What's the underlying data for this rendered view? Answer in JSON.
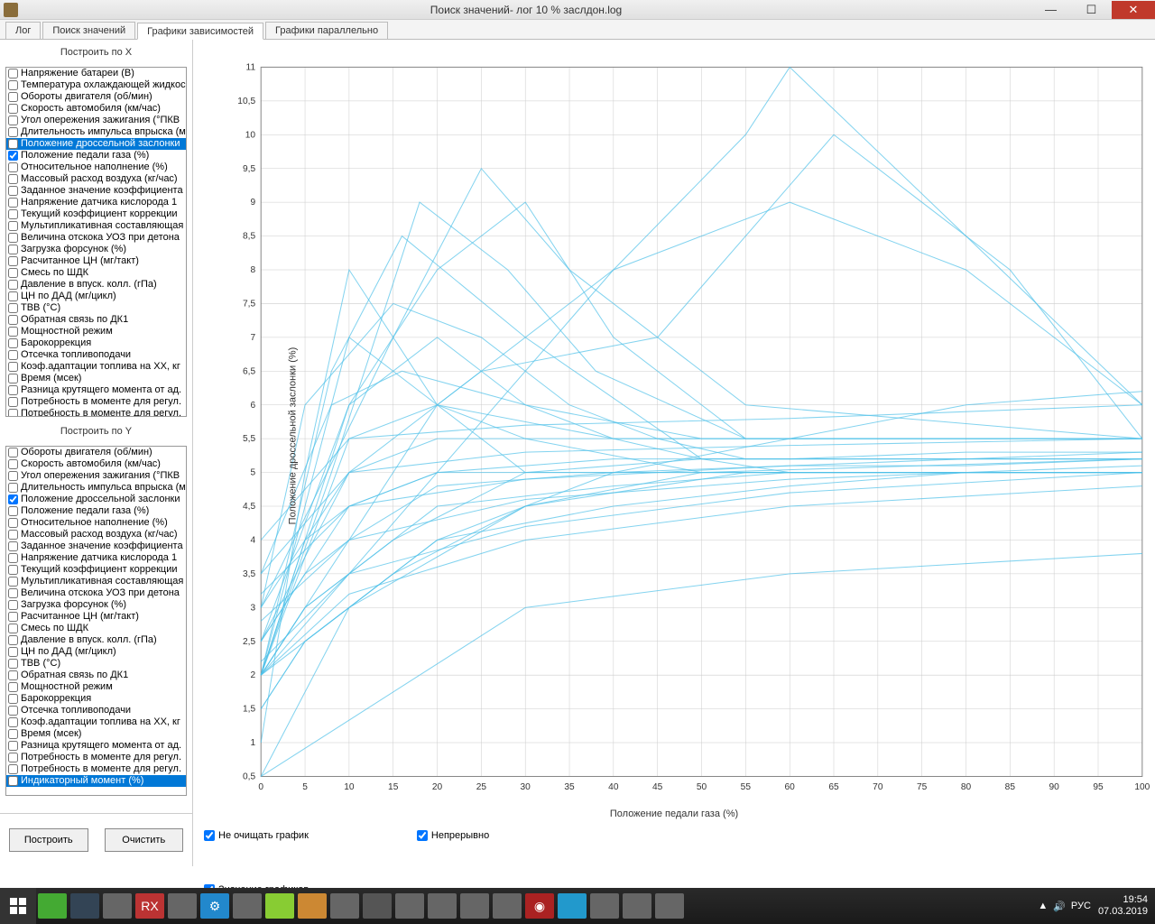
{
  "window": {
    "title": "Поиск значений- лог 10 % заслдон.log"
  },
  "tabs": [
    {
      "label": "Лог",
      "active": false
    },
    {
      "label": "Поиск значений",
      "active": false
    },
    {
      "label": "Графики зависимостей",
      "active": true
    },
    {
      "label": "Графики параллельно",
      "active": false
    }
  ],
  "xSection": {
    "header": "Построить по X",
    "items": [
      {
        "label": "Напряжение батареи (В)",
        "checked": false
      },
      {
        "label": "Температура охлаждающей жидкос",
        "checked": false
      },
      {
        "label": "Обороты  двигателя (об/мин)",
        "checked": false
      },
      {
        "label": "Скорость автомобиля (км/час)",
        "checked": false
      },
      {
        "label": "Угол опережения зажигания (°ПКВ",
        "checked": false
      },
      {
        "label": "Длительность импульса впрыска (м",
        "checked": false
      },
      {
        "label": "Положение дроссельной заслонки",
        "checked": false,
        "selected": true
      },
      {
        "label": "Положение педали газа (%)",
        "checked": true
      },
      {
        "label": "Относительное наполнение (%)",
        "checked": false
      },
      {
        "label": "Массовый расход воздуха (кг/час)",
        "checked": false
      },
      {
        "label": "Заданное значение коэффициента",
        "checked": false
      },
      {
        "label": "Напряжение датчика кислорода 1",
        "checked": false
      },
      {
        "label": "Текущий коэффициент коррекции",
        "checked": false
      },
      {
        "label": "Мультипликативная составляющая",
        "checked": false
      },
      {
        "label": "Величина отскока УОЗ при детона",
        "checked": false
      },
      {
        "label": "Загрузка форсунок (%)",
        "checked": false
      },
      {
        "label": "Расчитанное ЦН (мг/такт)",
        "checked": false
      },
      {
        "label": "Смесь по ШДК",
        "checked": false
      },
      {
        "label": "Давление в впуск. колл. (гПа)",
        "checked": false
      },
      {
        "label": "ЦН по ДАД (мг/цикл)",
        "checked": false
      },
      {
        "label": "ТВВ (°С)",
        "checked": false
      },
      {
        "label": "Обратная связь по ДК1",
        "checked": false
      },
      {
        "label": "Мощностной режим",
        "checked": false
      },
      {
        "label": "Барокоррекция",
        "checked": false
      },
      {
        "label": "Отсечка топливоподачи",
        "checked": false
      },
      {
        "label": "Коэф.адаптации топлива на ХХ, кг",
        "checked": false
      },
      {
        "label": "Время (мсек)",
        "checked": false
      },
      {
        "label": "Разница крутящего момента от ад.",
        "checked": false
      },
      {
        "label": "Потребность в моменте для регул.",
        "checked": false
      },
      {
        "label": "Потребность в моменте для регул.",
        "checked": false
      }
    ]
  },
  "ySection": {
    "header": "Построить по Y",
    "items": [
      {
        "label": "Обороты  двигателя (об/мин)",
        "checked": false
      },
      {
        "label": "Скорость автомобиля (км/час)",
        "checked": false
      },
      {
        "label": "Угол опережения зажигания (°ПКВ",
        "checked": false
      },
      {
        "label": "Длительность импульса впрыска (м",
        "checked": false
      },
      {
        "label": "Положение дроссельной заслонки",
        "checked": true
      },
      {
        "label": "Положение педали газа (%)",
        "checked": false
      },
      {
        "label": "Относительное наполнение (%)",
        "checked": false
      },
      {
        "label": "Массовый расход воздуха (кг/час)",
        "checked": false
      },
      {
        "label": "Заданное значение коэффициента",
        "checked": false
      },
      {
        "label": "Напряжение датчика кислорода 1",
        "checked": false
      },
      {
        "label": "Текущий коэффициент коррекции",
        "checked": false
      },
      {
        "label": "Мультипликативная составляющая",
        "checked": false
      },
      {
        "label": "Величина отскока УОЗ при детона",
        "checked": false
      },
      {
        "label": "Загрузка форсунок (%)",
        "checked": false
      },
      {
        "label": "Расчитанное ЦН (мг/такт)",
        "checked": false
      },
      {
        "label": "Смесь по ШДК",
        "checked": false
      },
      {
        "label": "Давление в впуск. колл. (гПа)",
        "checked": false
      },
      {
        "label": "ЦН по ДАД (мг/цикл)",
        "checked": false
      },
      {
        "label": "ТВВ (°С)",
        "checked": false
      },
      {
        "label": "Обратная связь по ДК1",
        "checked": false
      },
      {
        "label": "Мощностной режим",
        "checked": false
      },
      {
        "label": "Барокоррекция",
        "checked": false
      },
      {
        "label": "Отсечка топливоподачи",
        "checked": false
      },
      {
        "label": "Коэф.адаптации топлива на ХХ, кг",
        "checked": false
      },
      {
        "label": "Время (мсек)",
        "checked": false
      },
      {
        "label": "Разница крутящего момента от ад.",
        "checked": false
      },
      {
        "label": "Потребность в моменте для регул.",
        "checked": false
      },
      {
        "label": "Потребность в моменте для регул.",
        "checked": false
      },
      {
        "label": "Индикаторный момент (%)",
        "checked": false,
        "selected": true
      }
    ]
  },
  "buttons": {
    "build": "Построить",
    "clear": "Очистить"
  },
  "options": {
    "noClear": "Не очищать график",
    "continuous": "Непрерывно",
    "chartValues": "Значение графиков"
  },
  "taskbar": {
    "lang": "РУС",
    "time": "19:54",
    "date": "07.03.2019"
  },
  "chart_data": {
    "type": "line",
    "xlabel": "Положение педали газа (%)",
    "ylabel": "Положение дроссельной заслонки (%)",
    "xlim": [
      0,
      100
    ],
    "ylim": [
      0.5,
      11
    ],
    "xticks": [
      0,
      5,
      10,
      15,
      20,
      25,
      30,
      35,
      40,
      45,
      50,
      55,
      60,
      65,
      70,
      75,
      80,
      85,
      90,
      95,
      100
    ],
    "yticks": [
      0.5,
      1,
      1.5,
      2,
      2.5,
      3,
      3.5,
      4,
      4.5,
      5,
      5.5,
      6,
      6.5,
      7,
      7.5,
      8,
      8.5,
      9,
      9.5,
      10,
      10.5,
      11
    ],
    "series": [
      {
        "x": [
          0,
          5,
          10,
          20,
          40,
          60,
          80,
          100
        ],
        "y": [
          2,
          3,
          3.5,
          4.5,
          4.8,
          5,
          5,
          5
        ]
      },
      {
        "x": [
          0,
          5,
          10,
          20,
          40,
          60,
          80,
          100
        ],
        "y": [
          2.5,
          3.5,
          4,
          4.8,
          5,
          5.1,
          5.1,
          5.2
        ]
      },
      {
        "x": [
          0,
          5,
          10,
          20,
          40,
          60,
          80,
          100
        ],
        "y": [
          3,
          4,
          4.5,
          5,
          5.2,
          5.2,
          5.3,
          5.3
        ]
      },
      {
        "x": [
          0,
          5,
          10,
          20,
          40,
          60,
          80,
          100
        ],
        "y": [
          1.5,
          2.5,
          3,
          4,
          4.5,
          4.8,
          5,
          5
        ]
      },
      {
        "x": [
          0,
          5,
          10,
          20,
          40,
          60,
          80,
          100
        ],
        "y": [
          2,
          4,
          5,
          5.5,
          5.5,
          5.5,
          5.5,
          5.5
        ]
      },
      {
        "x": [
          0,
          10,
          20,
          30,
          40,
          50,
          60,
          70,
          80,
          90,
          100
        ],
        "y": [
          2,
          6,
          7,
          6,
          5.5,
          5.2,
          5,
          5,
          5,
          5,
          5
        ]
      },
      {
        "x": [
          0,
          5,
          15,
          25,
          35,
          45,
          55,
          100
        ],
        "y": [
          3,
          6,
          7.5,
          7,
          6,
          5.5,
          5.2,
          5.2
        ]
      },
      {
        "x": [
          0,
          8,
          18,
          28,
          38,
          55,
          100
        ],
        "y": [
          2,
          5,
          9,
          8,
          6.5,
          5.5,
          5.5
        ]
      },
      {
        "x": [
          0,
          10,
          20,
          30,
          40,
          55,
          100
        ],
        "y": [
          2.5,
          6,
          8,
          9,
          7,
          5.5,
          5.5
        ]
      },
      {
        "x": [
          0,
          15,
          25,
          35,
          55,
          100
        ],
        "y": [
          3,
          7,
          9.5,
          8,
          6,
          5.5
        ]
      },
      {
        "x": [
          0,
          20,
          40,
          55,
          60,
          100
        ],
        "y": [
          2,
          5,
          8,
          10,
          11,
          6
        ]
      },
      {
        "x": [
          0,
          10,
          30,
          55,
          100
        ],
        "y": [
          0.5,
          3,
          4.5,
          5,
          5
        ]
      },
      {
        "x": [
          0,
          10,
          30,
          60,
          100
        ],
        "y": [
          2,
          3.2,
          4,
          4.5,
          4.8
        ]
      },
      {
        "x": [
          0,
          10,
          30,
          60,
          100
        ],
        "y": [
          2.2,
          3.5,
          4.2,
          4.7,
          5
        ]
      },
      {
        "x": [
          0,
          10,
          30,
          60,
          100
        ],
        "y": [
          2.8,
          4,
          4.6,
          4.9,
          5.1
        ]
      },
      {
        "x": [
          0,
          10,
          30,
          60,
          100
        ],
        "y": [
          3.2,
          4.5,
          4.9,
          5.1,
          5.3
        ]
      },
      {
        "x": [
          0,
          10,
          30,
          60,
          100
        ],
        "y": [
          3.5,
          5,
          5.3,
          5.4,
          5.5
        ]
      },
      {
        "x": [
          0,
          10,
          30,
          60,
          100
        ],
        "y": [
          4,
          5.5,
          5.7,
          5.8,
          6
        ]
      },
      {
        "x": [
          0,
          10,
          20,
          30,
          50,
          100
        ],
        "y": [
          2,
          7,
          6,
          5.5,
          5,
          5
        ]
      },
      {
        "x": [
          0,
          5,
          10,
          20,
          30,
          100
        ],
        "y": [
          1,
          5,
          8,
          6,
          5,
          5
        ]
      },
      {
        "x": [
          0,
          10,
          20,
          40,
          60,
          80,
          100
        ],
        "y": [
          2,
          4,
          6,
          8,
          9,
          8,
          6
        ]
      },
      {
        "x": [
          0,
          10,
          25,
          45,
          65,
          85,
          100
        ],
        "y": [
          2.5,
          5,
          6.5,
          7,
          10,
          8,
          5.5
        ]
      },
      {
        "x": [
          0,
          8,
          16,
          30,
          50,
          100
        ],
        "y": [
          2,
          6.5,
          8.5,
          7,
          5.2,
          5.2
        ]
      },
      {
        "x": [
          0,
          8,
          16,
          30,
          50,
          100
        ],
        "y": [
          3.5,
          6,
          6.5,
          6,
          5.5,
          5.5
        ]
      },
      {
        "x": [
          0,
          5,
          15,
          30,
          50,
          100
        ],
        "y": [
          2,
          3,
          4,
          5,
          5.2,
          5.2
        ]
      },
      {
        "x": [
          0,
          5,
          15,
          30,
          50,
          100
        ],
        "y": [
          1.5,
          2.5,
          3.5,
          4.5,
          5,
          5.2
        ]
      },
      {
        "x": [
          0,
          10,
          20,
          40,
          100
        ],
        "y": [
          2,
          5.5,
          6,
          5.5,
          5.5
        ]
      },
      {
        "x": [
          0,
          10,
          20,
          40,
          100
        ],
        "y": [
          2.5,
          4.5,
          5,
          5,
          5
        ]
      },
      {
        "x": [
          0,
          20,
          40,
          60,
          80,
          100
        ],
        "y": [
          2,
          4,
          5,
          5.5,
          6,
          6.2
        ]
      },
      {
        "x": [
          0,
          30,
          60,
          100
        ],
        "y": [
          0.5,
          3,
          3.5,
          3.8
        ]
      }
    ]
  }
}
